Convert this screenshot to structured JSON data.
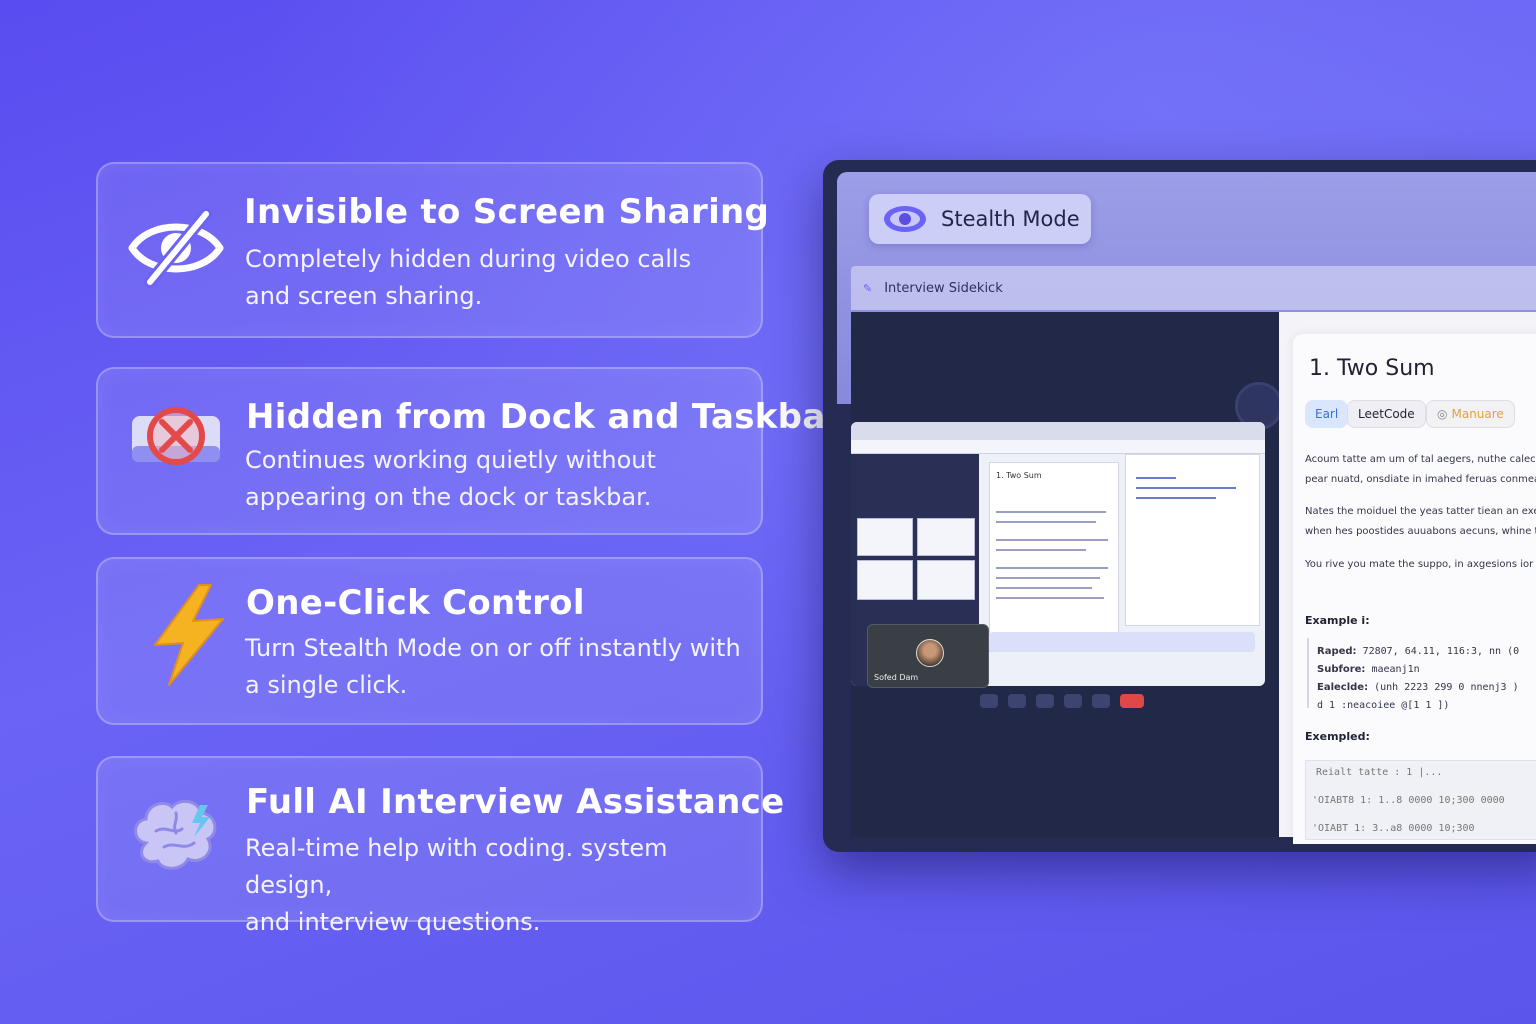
{
  "features": [
    {
      "title": "Invisible to Screen Sharing",
      "desc_line1": "Completely hidden during video calls",
      "desc_line2": "and screen sharing.",
      "icon": "eye-off-icon"
    },
    {
      "title": "Hidden from Dock and Taskbar",
      "desc_line1": "Continues working quietly without",
      "desc_line2": "appearing on the dock or taskbar.",
      "icon": "dock-blocked-icon"
    },
    {
      "title": "One-Click Control",
      "desc_line1": "Turn Stealth Mode on or off instantly with",
      "desc_line2": "a single click.",
      "icon": "lightning-icon"
    },
    {
      "title": "Full AI Interview Assistance",
      "desc_line1": "Real-time help with coding. system design,",
      "desc_line2": "and interview questions.",
      "icon": "brain-icon"
    }
  ],
  "app": {
    "stealth_label": "Stealth Mode",
    "sidekick_label": "Interview Sidekick",
    "video_name": "Sofed Dam",
    "problem": {
      "title": "1. Two Sum",
      "tags": {
        "easy": "Earl",
        "site": "LeetCode",
        "mode": "Manuare"
      },
      "para1_line1": "Acoum tatte am um of tal aegers, nuthe calec tella",
      "para1_line2": "pear nuatd, onsdiate in imahed feruas conmead, a",
      "para2_line1": "Nates the moiduel the yeas tatter tiean an exert",
      "para2_line2": "when hes poostides auuabons aecuns, whine tese",
      "para3_line1": "You rive you mate the suppo, in axgesions ior al",
      "example_heading": "Example i:",
      "ex_line1_label": "Raped:",
      "ex_line1_value": "72807, 64.11, 116:3, nn (0",
      "ex_line2_label": "Subfore:",
      "ex_line2_value": "maeanj1n",
      "ex_line3_label": "Ealeclde:",
      "ex_line3_value": "(unh 2223 299 0 nnenj3 )",
      "ex_line4": "d 1 :neacoiee @[1 1 ])",
      "exampled_heading": "Exempled:",
      "box_line1": "Reialt tatte :  1 |...",
      "box_line2": "'OIABT8 1:  1..8  0000 10;300 0000",
      "box_line3": "'OIABT 1:  3..a8  0000 10;300"
    }
  },
  "colors": {
    "bg_top": "#5a4cf0",
    "bg_bottom": "#5b55ec",
    "frame": "#252b52",
    "bolt": "#f5b321",
    "block_red": "#e24a4a"
  }
}
